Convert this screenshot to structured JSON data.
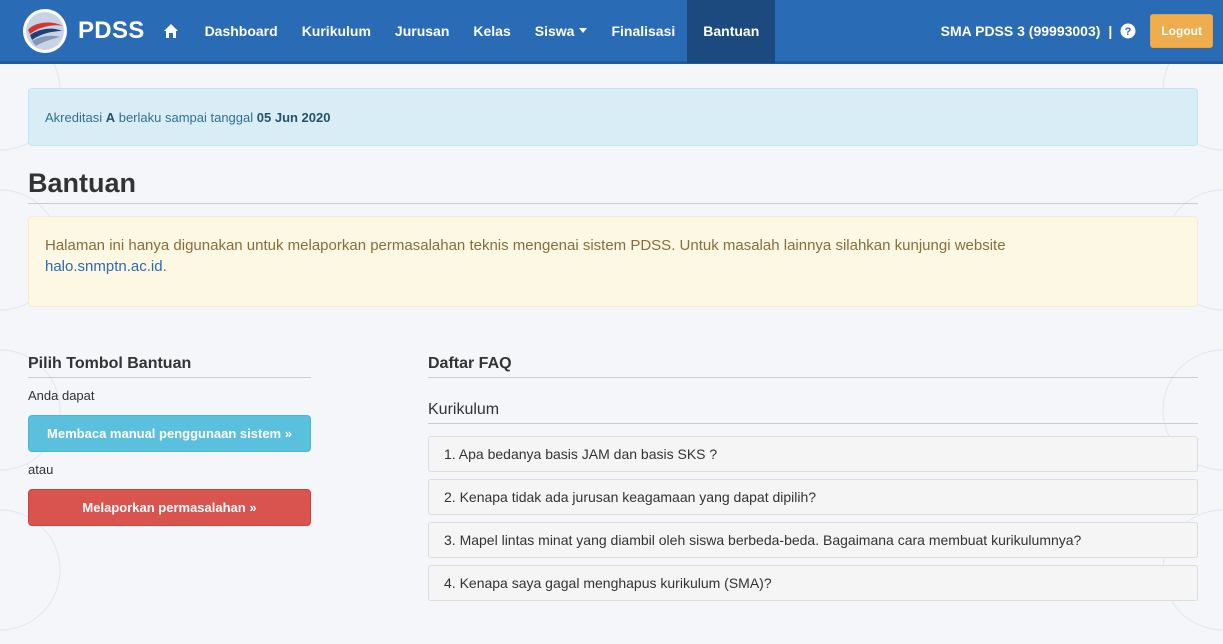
{
  "navbar": {
    "brand": "PDSS",
    "items": [
      {
        "label": "Dashboard"
      },
      {
        "label": "Kurikulum"
      },
      {
        "label": "Jurusan"
      },
      {
        "label": "Kelas"
      },
      {
        "label": "Siswa"
      },
      {
        "label": "Finalisasi"
      },
      {
        "label": "Bantuan",
        "active": true
      }
    ],
    "school": "SMA PDSS 3 (99993003)",
    "separator": "|",
    "logout": "Logout",
    "icons": {
      "home": "home-icon",
      "help": "question-circle-icon"
    },
    "colors": {
      "bar": "#2a6bb5",
      "active": "#1d4a7e",
      "logout": "#f0ad4e"
    }
  },
  "accreditation": {
    "prefix": "Akreditasi",
    "grade": "A",
    "middle": "berlaku sampai tanggal",
    "date": "05 Jun 2020"
  },
  "page_title": "Bantuan",
  "notice": {
    "text": "Halaman ini hanya digunakan untuk melaporkan permasalahan teknis mengenai sistem PDSS. Untuk masalah lainnya silahkan kunjungi website",
    "link": "halo.snmptn.ac.id",
    "suffix": "."
  },
  "help": {
    "title": "Pilih Tombol Bantuan",
    "intro": "Anda dapat",
    "manual_button": "Membaca manual penggunaan sistem »",
    "or": "atau",
    "report_button": "Melaporkan permasalahan »"
  },
  "faq": {
    "title": "Daftar FAQ",
    "category": "Kurikulum",
    "items": [
      "1.  Apa bedanya basis JAM dan basis SKS ?",
      "2.  Kenapa tidak ada jurusan keagamaan yang dapat dipilih?",
      "3.  Mapel lintas minat yang diambil oleh siswa berbeda-beda. Bagaimana cara membuat kurikulumnya?",
      "4.  Kenapa saya gagal menghapus kurikulum (SMA)?"
    ]
  }
}
